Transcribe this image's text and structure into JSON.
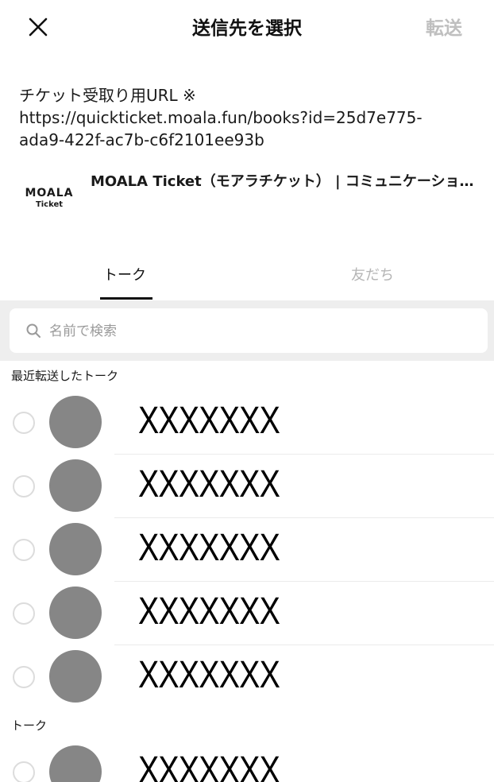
{
  "header": {
    "close_icon": "close-icon",
    "title": "送信先を選択",
    "forward_label": "転送"
  },
  "message": {
    "line1": "チケット受取り用URL ※",
    "line2": "https://quickticket.moala.fun/books?id=25d7e775-",
    "line3": "ada9-422f-ac7b-c6f2101ee93b"
  },
  "preview": {
    "logo_main": "MOALA",
    "logo_sub": "Ticket",
    "title": "MOALA Ticket（モアラチケット） | コミュニケーションサービス"
  },
  "tabs": {
    "talk": "トーク",
    "friends": "友だち",
    "active": "talk"
  },
  "search": {
    "icon": "search-icon",
    "placeholder": "名前で検索",
    "value": ""
  },
  "sections": {
    "recent_label": "最近転送したトーク",
    "talk_label": "トーク"
  },
  "recent_items": [
    {
      "name": "XXXXXXX"
    },
    {
      "name": "XXXXXXX"
    },
    {
      "name": "XXXXXXX"
    },
    {
      "name": "XXXXXXX"
    },
    {
      "name": "XXXXXXX"
    }
  ],
  "talk_items": [
    {
      "name": "XXXXXXX"
    }
  ],
  "colors": {
    "accent_disabled": "#bfbfbf",
    "avatar": "#868686",
    "band": "#eeeeee"
  }
}
